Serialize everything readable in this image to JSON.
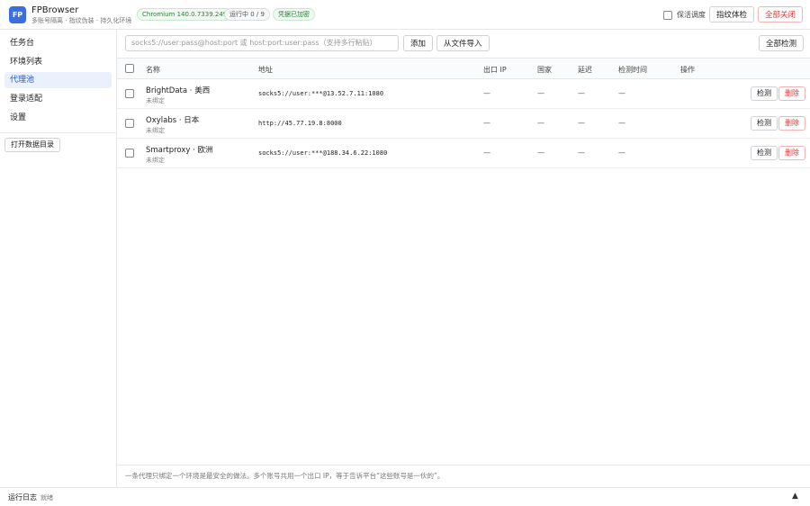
{
  "header": {
    "logo_text": "FP",
    "app_name": "FPBrowser",
    "subtitle": "多账号隔离 · 指纹伪装 · 持久化环境",
    "badges": {
      "chromium": "Chromium 140.0.7339.249",
      "running": "运行中 0 / 9",
      "credentials": "凭据已加密"
    },
    "keepalive_label": "保活调度",
    "fingerprint_check_label": "指纹体检",
    "close_all_label": "全部关闭"
  },
  "sidebar": {
    "items": [
      {
        "label": "任务台"
      },
      {
        "label": "环境列表"
      },
      {
        "label": "代理池"
      },
      {
        "label": "登录适配"
      },
      {
        "label": "设置"
      }
    ],
    "open_data_dir_label": "打开数据目录"
  },
  "toolbar": {
    "input_placeholder": "socks5://user:pass@host:port  或  host:port:user:pass（支持多行粘贴）",
    "add_label": "添加",
    "import_label": "从文件导入",
    "check_all_label": "全部检测"
  },
  "table": {
    "columns": {
      "name": "名称",
      "address": "地址",
      "exit_ip": "出口 IP",
      "country": "国家",
      "latency": "延迟",
      "check_time": "检测时间",
      "actions": "操作"
    },
    "rows": [
      {
        "name": "BrightData · 美西",
        "binding": "未绑定",
        "address": "socks5://user:***@13.52.7.11:1080",
        "exit_ip": "—",
        "country": "—",
        "latency": "—",
        "check_time": "—",
        "check_label": "检测",
        "delete_label": "删除"
      },
      {
        "name": "Oxylabs · 日本",
        "binding": "未绑定",
        "address": "http://45.77.19.8:8000",
        "exit_ip": "—",
        "country": "—",
        "latency": "—",
        "check_time": "—",
        "check_label": "检测",
        "delete_label": "删除"
      },
      {
        "name": "Smartproxy · 欧洲",
        "binding": "未绑定",
        "address": "socks5://user:***@188.34.6.22:1080",
        "exit_ip": "—",
        "country": "—",
        "latency": "—",
        "check_time": "—",
        "check_label": "检测",
        "delete_label": "删除"
      }
    ]
  },
  "footer_note": "一条代理只绑定一个环境是最安全的做法。多个账号共用一个出口 IP，等于告诉平台“这些账号是一伙的”。",
  "statusbar": {
    "log_label": "运行日志",
    "log_status": "就绪",
    "expand_icon_glyph": "▲"
  },
  "colors": {
    "accent": "#3b6fe0",
    "active_nav_bg": "#eaf1fd",
    "danger": "#d93636",
    "success": "#2f7d3a"
  }
}
